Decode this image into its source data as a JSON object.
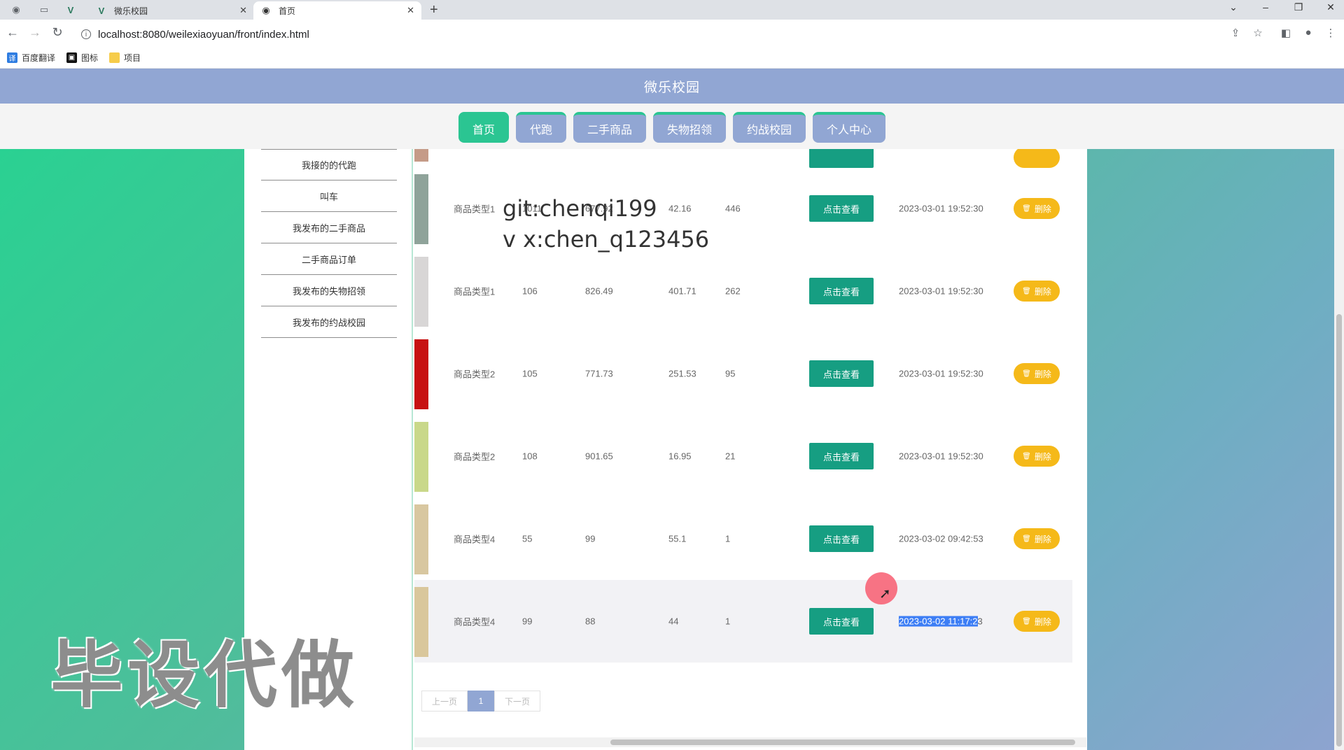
{
  "browser": {
    "tabs": [
      {
        "title": "微乐校园",
        "active": false
      },
      {
        "title": "首页",
        "active": true
      }
    ],
    "url": "localhost:8080/weilexiaoyuan/front/index.html",
    "bookmarks": [
      {
        "label": "百度翻译"
      },
      {
        "label": "图标"
      },
      {
        "label": "项目"
      }
    ]
  },
  "site": {
    "title": "微乐校园",
    "nav": [
      "首页",
      "代跑",
      "二手商品",
      "失物招领",
      "约战校园",
      "个人中心"
    ],
    "active_nav": 0
  },
  "sidebar": {
    "items": [
      "我接的的代跑",
      "叫车",
      "我发布的二手商品",
      "二手商品订单",
      "我发布的失物招领",
      "我发布的约战校园"
    ]
  },
  "table": {
    "view_label": "点击查看",
    "delete_label": "删除",
    "rows": [
      {
        "type": "商品类型1",
        "a": "1011",
        "b": "677.92",
        "c": "42.16",
        "d": "446",
        "time": "2023-03-01 19:52:30",
        "thumb": "#8fa39a"
      },
      {
        "type": "商品类型1",
        "a": "106",
        "b": "826.49",
        "c": "401.71",
        "d": "262",
        "time": "2023-03-01 19:52:30",
        "thumb": "#d8d6d6"
      },
      {
        "type": "商品类型2",
        "a": "105",
        "b": "771.73",
        "c": "251.53",
        "d": "95",
        "time": "2023-03-01 19:52:30",
        "thumb": "#c71212"
      },
      {
        "type": "商品类型2",
        "a": "108",
        "b": "901.65",
        "c": "16.95",
        "d": "21",
        "time": "2023-03-01 19:52:30",
        "thumb": "#c9d88a"
      },
      {
        "type": "商品类型4",
        "a": "55",
        "b": "99",
        "c": "55.1",
        "d": "1",
        "time": "2023-03-02 09:42:53",
        "thumb": "#d8c7a0"
      },
      {
        "type": "商品类型4",
        "a": "99",
        "b": "88",
        "c": "44",
        "d": "1",
        "time": "2023-03-02 11:17:23",
        "time_selected": "2023-03-02 11:17:2",
        "time_rest": "3",
        "thumb": "#d9c79c"
      }
    ]
  },
  "pagination": {
    "prev": "上一页",
    "current": "1",
    "next": "下一页"
  },
  "watermark": {
    "git_line1": "git:chenqi199",
    "git_line2": "v x:chen_q123456",
    "big": "毕设代做"
  },
  "colors": {
    "header": "#91a6d3",
    "accent_green": "#2bc592",
    "view_button": "#169e82",
    "delete_button": "#f5b919"
  }
}
